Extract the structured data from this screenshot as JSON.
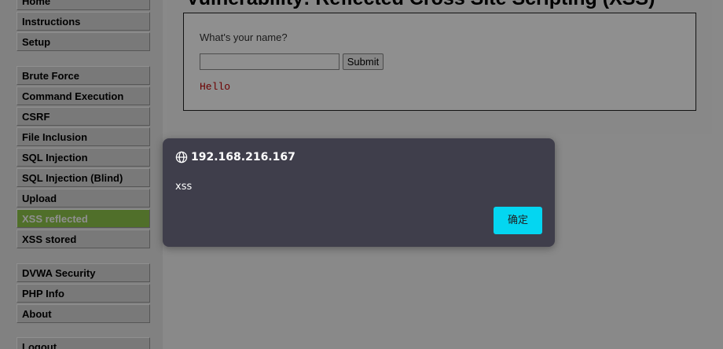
{
  "page": {
    "heading": "Vulnerability: Reflected Cross Site Scripting (XSS)"
  },
  "sidebar": {
    "group1": [
      {
        "label": "Home"
      },
      {
        "label": "Instructions"
      },
      {
        "label": "Setup"
      }
    ],
    "group2": [
      {
        "label": "Brute Force"
      },
      {
        "label": "Command Execution"
      },
      {
        "label": "CSRF"
      },
      {
        "label": "File Inclusion"
      },
      {
        "label": "SQL Injection"
      },
      {
        "label": "SQL Injection (Blind)"
      },
      {
        "label": "Upload"
      },
      {
        "label": "XSS reflected",
        "selected": true
      },
      {
        "label": "XSS stored"
      }
    ],
    "group3": [
      {
        "label": "DVWA Security"
      },
      {
        "label": "PHP Info"
      },
      {
        "label": "About"
      }
    ],
    "group4": [
      {
        "label": "Logout"
      }
    ]
  },
  "form": {
    "label": "What's your name?",
    "input_value": "",
    "submit_label": "Submit",
    "output_text": "Hello"
  },
  "alert": {
    "host": "192.168.216.167",
    "message": "xss",
    "ok_label": "确定",
    "icon": "globe-icon",
    "button_color": "#04d6f1"
  },
  "colors": {
    "selected_menu": "#8fc74b",
    "output_text": "#c00000"
  }
}
